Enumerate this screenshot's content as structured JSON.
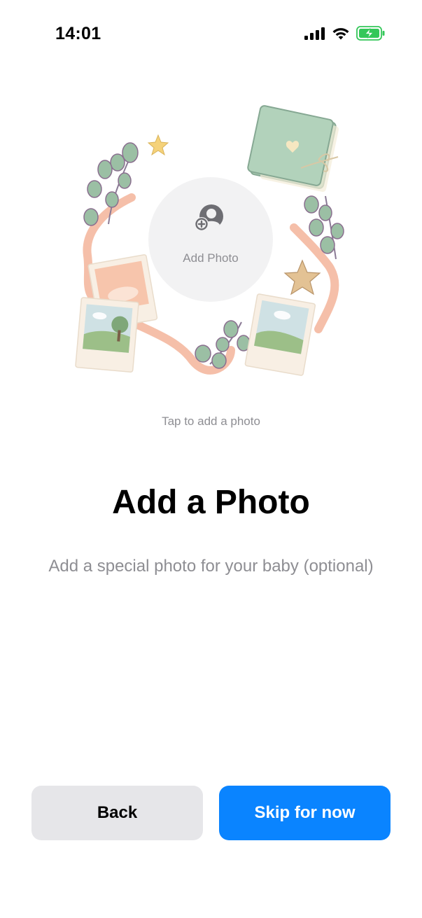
{
  "status_bar": {
    "time": "14:01",
    "icons": [
      "cellular-signal-icon",
      "wifi-icon",
      "battery-charging-icon"
    ]
  },
  "photo_picker": {
    "label": "Add Photo",
    "icon": "add-person-icon",
    "hint": "Tap to add a photo"
  },
  "content": {
    "title": "Add a Photo",
    "subtitle": "Add a special photo for your baby (optional)"
  },
  "actions": {
    "back_label": "Back",
    "skip_label": "Skip for now"
  },
  "colors": {
    "accent": "#0a84ff",
    "secondary_button": "#e6e6e9",
    "secondary_text": "#8e8e93",
    "battery": "#34c759"
  }
}
